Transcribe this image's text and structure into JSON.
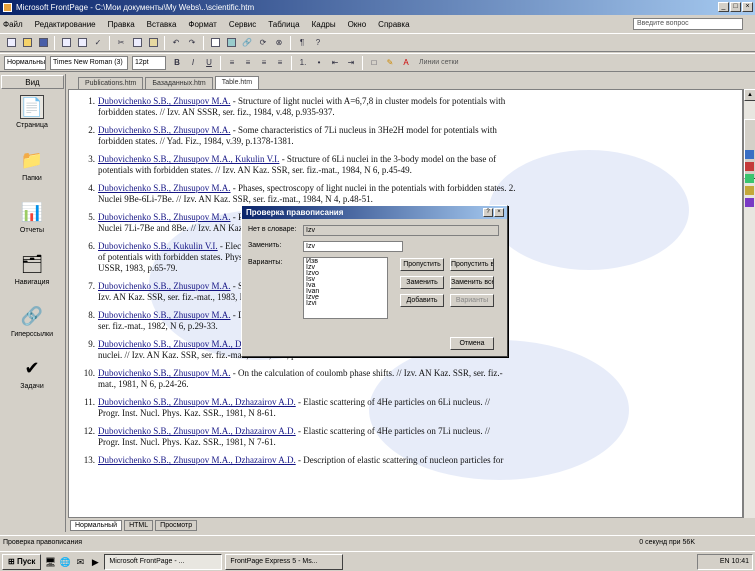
{
  "window": {
    "title": "Microsoft FrontPage - C:\\Мои документы\\My Webs\\..\\scientific.htm"
  },
  "menu": [
    "Файл",
    "Редактирование",
    "Правка",
    "Вставка",
    "Формат",
    "Сервис",
    "Таблица",
    "Кадры",
    "Окно",
    "Справка"
  ],
  "help_placeholder": "Введите вопрос",
  "toolbar": {
    "style": "Нормальный",
    "font": "Times New Roman (3)",
    "size": "12pt",
    "align_label": "Линии сетки"
  },
  "views": {
    "header": "Вид",
    "items": [
      {
        "label": "Страница",
        "icon": "page-icon",
        "glyph": "📄"
      },
      {
        "label": "Папки",
        "icon": "folder-icon",
        "glyph": "📁"
      },
      {
        "label": "Отчеты",
        "icon": "reports-icon",
        "glyph": "📊"
      },
      {
        "label": "Навигация",
        "icon": "navigation-icon",
        "glyph": "🗂"
      },
      {
        "label": "Гиперссылки",
        "icon": "hyperlinks-icon",
        "glyph": "🔗"
      },
      {
        "label": "Задачи",
        "icon": "tasks-icon",
        "glyph": "✔"
      }
    ]
  },
  "tabs": [
    "Publications.htm",
    "Базаданных.htm",
    "Table.htm"
  ],
  "references": [
    {
      "n": "1.",
      "authors": "Dubovichenko S.B., Zhusupov M.A.",
      "text": " - Structure of light nuclei with A=6,7,8 in cluster models for potentials with"
    },
    {
      "n": "",
      "authors": "",
      "text": "forbidden states. // Izv. AN SSSR, ser. fiz., 1984, v.48, p.935-937."
    },
    {
      "n": "2.",
      "authors": "Dubovichenko S.B., Zhusupov M.A.",
      "text": " - Some characteristics of 7Li nucleus in 3He2H model for potentials with"
    },
    {
      "n": "",
      "authors": "",
      "text": "forbidden states. // Yad. Fiz., 1984, v.39, p.1378-1381."
    },
    {
      "n": "3.",
      "authors": "Dubovichenko S.B., Zhusupov M.A., Kukulin V.I.",
      "text": " - Structure of 6Li nuclei in the 3-body model on the base of"
    },
    {
      "n": "",
      "authors": "",
      "text": "potentials with forbidden states. // Izv. AN Kaz. SSR, ser. fiz.-mat., 1984, N 6, p.45-49."
    },
    {
      "n": "4.",
      "authors": "Dubovichenko S.B., Zhusupov M.A.",
      "text": " - Phases, spectroscopy of light nuclei in the potentials with forbidden states. 2."
    },
    {
      "n": "",
      "authors": "",
      "text": "Nuclei 9Be-6Li-7Be. // Izv. AN Kaz. SSR, ser. fiz.-mat., 1984, N 4, p.48-51."
    },
    {
      "n": "5.",
      "authors": "Dubovichenko S.B., Zhusupov M.A.",
      "text": " - Phases and spectroscopy in the potentials with forbidden states. 1."
    },
    {
      "n": "",
      "authors": "",
      "text": "Nuclei 7Li-7Be and 8Be. // Izv. AN Kaz. SSR, ser. fiz.-mat., 1984, N 4, p.44-51."
    },
    {
      "n": "6.",
      "authors": "Dubovichenko S.B., Kukulin V.I.",
      "text": " - Electromagnetic moments in the cluster models on the base"
    },
    {
      "n": "",
      "authors": "",
      "text": "of potentials with forbidden states. Physics of few body systems with strong interactions. Kalinin, KGU,"
    },
    {
      "n": "",
      "authors": "",
      "text": "USSR, 1983, p.65-79."
    },
    {
      "n": "7.",
      "authors": "Dubovichenko S.B., Zhusupov M.A.",
      "text": " - Scattering of light nuclei by the potential with forbidden states. //"
    },
    {
      "n": "",
      "authors": "",
      "text": "Izv. AN Kaz. SSR, ser. fiz.-mat., 1983, N 4, p.60-65."
    },
    {
      "n": "8.",
      "authors": "Dubovichenko S.B., Zhusupov M.A.",
      "text": " - Description of scattering in deep attractive potential. // Izv. AN Kaz. SSR,"
    },
    {
      "n": "",
      "authors": "",
      "text": "ser. fiz.-mat., 1982, N 6, p.29-33."
    },
    {
      "n": "9.",
      "authors": "Dubovichenko S.B., Zhusupov M.A., Dzhazairov A.D.",
      "text": " - Description of 4He elastic scattering on 4He and 6Li"
    },
    {
      "n": "",
      "authors": "",
      "text": "nuclei. // Izv. AN Kaz. SSR, ser. fiz.-mat., 1981, N 6, p.27-31."
    },
    {
      "n": "10.",
      "authors": "Dubovichenko S.B., Zhusupov M.A.",
      "text": " - On the calculation of coulomb phase shifts. // Izv. AN Kaz. SSR, ser. fiz.-"
    },
    {
      "n": "",
      "authors": "",
      "text": "mat., 1981, N 6, p.24-26."
    },
    {
      "n": "11.",
      "authors": "Dubovichenko S.B., Zhusupov M.A., Dzhazairov A.D.",
      "text": " - Elastic scattering of 4He particles on 6Li nucleus. //"
    },
    {
      "n": "",
      "authors": "",
      "text": "Progr. Inst. Nucl. Phys. Kaz. SSR., 1981, N 8-61."
    },
    {
      "n": "12.",
      "authors": "Dubovichenko S.B., Zhusupov M.A., Dzhazairov A.D.",
      "text": " - Elastic scattering of 4He particles on 7Li nucleus. //"
    },
    {
      "n": "",
      "authors": "",
      "text": "Progr. Inst. Nucl. Phys. Kaz. SSR., 1981, N 7-61."
    },
    {
      "n": "13.",
      "authors": "Dubovichenko S.B., Zhusupov M.A., Dzhazairov A.D.",
      "text": " - Description of elastic scattering of nucleon particles for"
    }
  ],
  "dialog": {
    "title": "Проверка правописания",
    "not_in_dict_label": "Нет в словаре:",
    "not_in_dict_value": "Izv",
    "change_to_label": "Заменить:",
    "change_to_value": "Izv",
    "suggestions_label": "Варианты:",
    "suggestions": [
      "Изв",
      "Izv",
      "Izvo",
      "Isv",
      "Iva",
      "Ivan",
      "Izve",
      "Izvi"
    ],
    "buttons": {
      "ignore": "Пропустить",
      "ignore_all": "Пропустить все",
      "change": "Заменить",
      "change_all": "Заменить все",
      "add": "Добавить",
      "suggest": "Варианты",
      "cancel": "Отмена"
    }
  },
  "view_tabs": [
    "Нормальный",
    "HTML",
    "Просмотр"
  ],
  "status": {
    "left": "Проверка правописания",
    "right": "0 секунд при 56K"
  },
  "taskbar": {
    "start": "Пуск",
    "tasks": [
      "Microsoft FrontPage - ...",
      "FrontPage Express 5 - Ms..."
    ],
    "clock": "EN 10:41"
  }
}
